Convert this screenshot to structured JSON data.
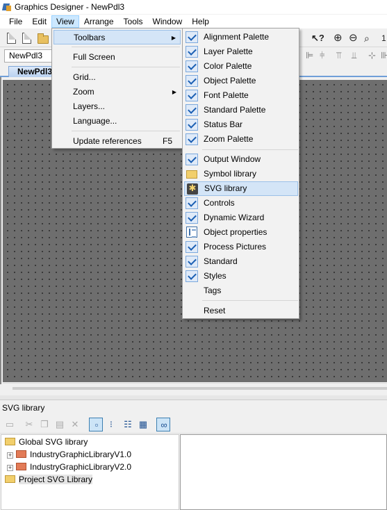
{
  "window": {
    "title": "Graphics Designer - NewPdl3"
  },
  "menubar": {
    "items": [
      "File",
      "Edit",
      "View",
      "Arrange",
      "Tools",
      "Window",
      "Help"
    ]
  },
  "toolbar": {
    "object_combo_value": "NewPdl3",
    "partial_field_value": "1"
  },
  "document_tab": {
    "label": "NewPdl3"
  },
  "view_menu": {
    "items": [
      {
        "label": "Toolbars",
        "submenu": true,
        "highlighted": true
      },
      {
        "label": "Full Screen"
      },
      {
        "label": "Grid..."
      },
      {
        "label": "Zoom",
        "submenu": true
      },
      {
        "label": "Layers..."
      },
      {
        "label": "Language..."
      },
      {
        "label": "Update references",
        "shortcut": "F5"
      }
    ]
  },
  "toolbars_menu": {
    "items": [
      {
        "label": "Alignment Palette",
        "checked": true
      },
      {
        "label": "Layer Palette",
        "checked": true
      },
      {
        "label": "Color Palette",
        "checked": true
      },
      {
        "label": "Object Palette",
        "checked": true
      },
      {
        "label": "Font Palette",
        "checked": true
      },
      {
        "label": "Standard Palette",
        "checked": true
      },
      {
        "label": "Status Bar",
        "checked": true
      },
      {
        "label": "Zoom Palette",
        "checked": true
      },
      {
        "label": "Output Window",
        "checked": true
      },
      {
        "label": "Symbol library",
        "icon": "folder-icon"
      },
      {
        "label": "SVG library",
        "icon": "svg-library-icon",
        "highlighted": true
      },
      {
        "label": "Controls",
        "checked": true
      },
      {
        "label": "Dynamic Wizard",
        "checked": true
      },
      {
        "label": "Object properties",
        "icon": "object-properties-icon"
      },
      {
        "label": "Process Pictures",
        "checked": true
      },
      {
        "label": "Standard",
        "checked": true
      },
      {
        "label": "Styles",
        "checked": true
      },
      {
        "label": "Tags"
      },
      {
        "label": "Reset"
      }
    ]
  },
  "svg_library_panel": {
    "title": "SVG library",
    "tree": [
      {
        "label": "Global SVG library"
      },
      {
        "label": "IndustryGraphicLibraryV1.0",
        "expander": "+"
      },
      {
        "label": "IndustryGraphicLibraryV2.0",
        "expander": "+"
      },
      {
        "label": "Project SVG Library",
        "selected": true
      }
    ]
  },
  "colors": {
    "menu_highlight": "#d4e5f7",
    "check_blue": "#1b5fb3",
    "canvas": "#6e6e6e",
    "tab_accent": "#6f9fd8"
  }
}
